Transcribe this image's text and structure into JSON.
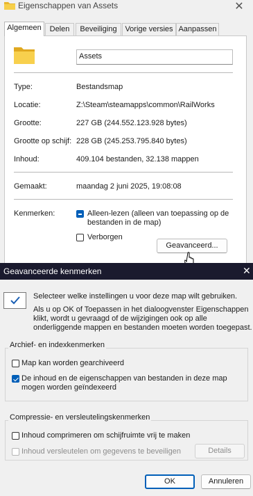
{
  "props": {
    "title": "Eigenschappen van Assets",
    "tabs": [
      "Algemeen",
      "Delen",
      "Beveiliging",
      "Vorige versies",
      "Aanpassen"
    ],
    "name": "Assets",
    "fields": [
      {
        "label": "Type:",
        "value": "Bestandsmap"
      },
      {
        "label": "Locatie:",
        "value": "Z:\\Steam\\steamapps\\common\\RailWorks"
      },
      {
        "label": "Grootte:",
        "value": "227 GB (244.552.123.928 bytes)"
      },
      {
        "label": "Grootte op schijf:",
        "value": "228 GB (245.253.795.840 bytes)"
      },
      {
        "label": "Inhoud:",
        "value": "409.104 bestanden, 32.138 mappen"
      }
    ],
    "created_label": "Gemaakt:",
    "created_value": "maandag 2 juni 2025, 19:08:08",
    "attributes_label": "Kenmerken:",
    "readonly_line1": "Alleen-lezen (alleen van toepassing op de",
    "readonly_line2": "bestanden in de map)",
    "hidden_label": "Verborgen",
    "advanced_button": "Geavanceerd..."
  },
  "advanced": {
    "title": "Geavanceerde kenmerken",
    "intro": "Selecteer welke instellingen u voor deze map wilt gebruiken.",
    "info_line1": "Als u op OK of Toepassen in het dialoogvenster Eigenschappen",
    "info_line2": "klikt, wordt u gevraagd of de wijzigingen ook op alle",
    "info_line3": "onderliggende mappen en bestanden moeten worden toegepast.",
    "group1_title": "Archief- en indexkenmerken",
    "archive_label": "Map kan worden gearchiveerd",
    "index_line1": "De inhoud en de eigenschappen van bestanden in deze map",
    "index_line2": "mogen worden geïndexeerd",
    "group2_title": "Compressie- en versleutelingskenmerken",
    "compress_label": "Inhoud comprimeren om schijfruimte vrij te maken",
    "encrypt_label": "Inhoud versleutelen om gegevens te beveiligen",
    "details_button": "Details",
    "ok_button": "OK",
    "cancel_button": "Annuleren"
  }
}
